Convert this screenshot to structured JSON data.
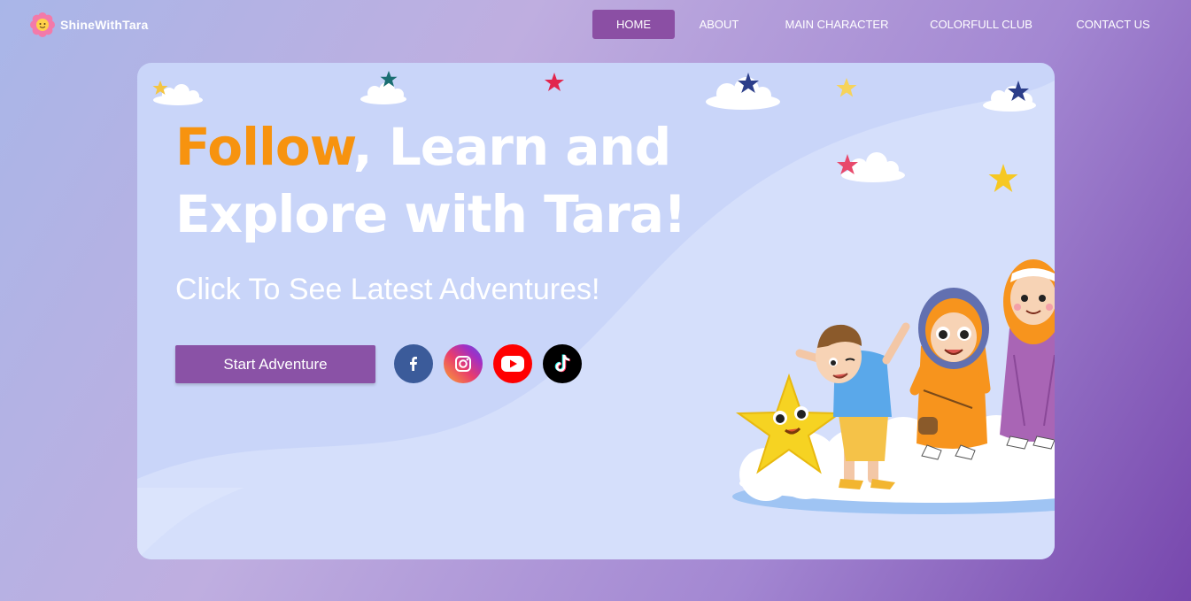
{
  "brand": {
    "name": "ShineWithTara",
    "logo_icon": "flower-logo-icon"
  },
  "nav": {
    "items": [
      {
        "label": "HOME",
        "active": true
      },
      {
        "label": "ABOUT",
        "active": false
      },
      {
        "label": "MAIN CHARACTER",
        "active": false
      },
      {
        "label": "COLORFULL CLUB",
        "active": false
      },
      {
        "label": "CONTACT US",
        "active": false
      }
    ]
  },
  "hero": {
    "headline_accent": "Follow",
    "headline_rest_line1": ", Learn and",
    "headline_line2": "Explore with Tara!",
    "subheadline": "Click To See Latest Adventures!",
    "cta_label": "Start Adventure"
  },
  "social": [
    {
      "icon": "facebook-icon",
      "color": "#3b5b9a"
    },
    {
      "icon": "instagram-icon",
      "color": "#e93d6c"
    },
    {
      "icon": "youtube-icon",
      "color": "#ff0000"
    },
    {
      "icon": "tiktok-icon",
      "color": "#000000"
    }
  ],
  "colors": {
    "accent_orange": "#f7930f",
    "button_purple": "#8a52a6",
    "nav_active": "#8b4fa4"
  }
}
